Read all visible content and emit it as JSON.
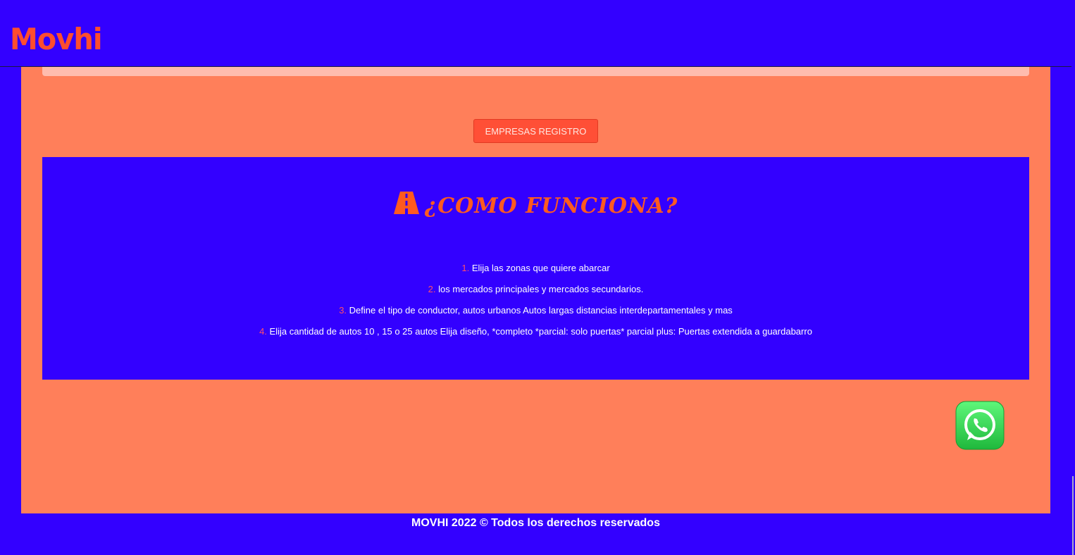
{
  "header": {
    "logo_text": "Movhi"
  },
  "main": {
    "register_button_label": "EMPRESAS REGISTRO",
    "how_it_works": {
      "title": "¿COMO FUNCIONA?",
      "title_icon": "road-icon",
      "steps": [
        {
          "number": "1.",
          "text": "Elija las zonas que quiere abarcar"
        },
        {
          "number": "2.",
          "text": "los mercados principales y mercados secundarios."
        },
        {
          "number": "3.",
          "text": "Define el tipo de conductor, autos urbanos Autos largas distancias interdepartamentales y mas"
        },
        {
          "number": "4.",
          "text": "Elija cantidad de autos 10 , 15 o 25 autos Elija diseño, *completo *parcial: solo puertas* parcial plus: Puertas extendida a guardabarro"
        }
      ]
    },
    "floating_icon": "whatsapp-icon"
  },
  "footer": {
    "copyright": "MOVHI 2022 © Todos los derechos reservados"
  },
  "colors": {
    "page_background": "#3300ff",
    "main_panel": "#ff7f5a",
    "accent_orange": "#ff4d2e",
    "button": "#ff4f36",
    "step_number": "#ff4d6a",
    "whatsapp_green": "#25d366"
  }
}
